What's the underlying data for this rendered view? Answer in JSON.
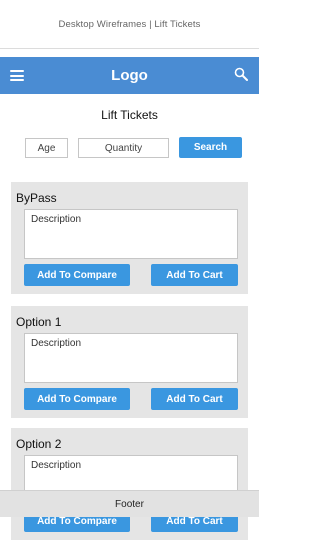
{
  "topbar": {
    "title": "Desktop Wireframes  |  Lift Tickets"
  },
  "header": {
    "logo": "Logo",
    "menu_icon": "hamburger-menu-icon",
    "search_icon": "search-icon",
    "color": "#4a8cd3"
  },
  "page": {
    "title": "Lift Tickets"
  },
  "search_form": {
    "age_placeholder": "Age",
    "quantity_placeholder": "Quantity",
    "search_label": "Search"
  },
  "options": [
    {
      "title": "ByPass",
      "description": "Description",
      "compare_label": "Add To Compare",
      "cart_label": "Add To Cart"
    },
    {
      "title": "Option 1",
      "description": "Description",
      "compare_label": "Add To Compare",
      "cart_label": "Add To Cart"
    },
    {
      "title": "Option 2",
      "description": "Description",
      "compare_label": "Add To Compare",
      "cart_label": "Add To Cart"
    }
  ],
  "footer": {
    "text": "Footer"
  },
  "colors": {
    "button": "#3a97e0",
    "card": "#e5e5e5",
    "footer": "#e2e2e2"
  }
}
